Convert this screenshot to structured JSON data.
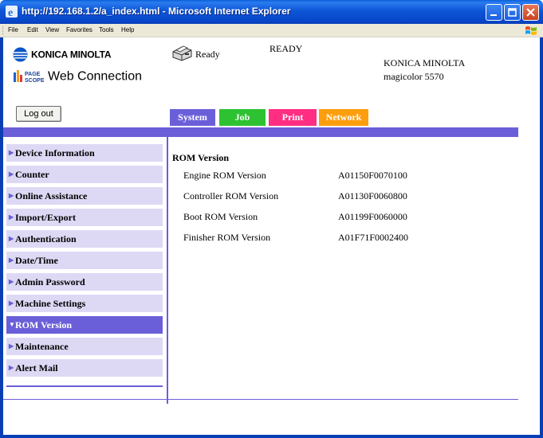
{
  "window": {
    "title": "http://192.168.1.2/a_index.html - Microsoft Internet Explorer",
    "menu": [
      "File",
      "Edit",
      "View",
      "Favorites",
      "Tools",
      "Help"
    ]
  },
  "header": {
    "brand_logo": "KONICA MINOLTA",
    "app_logo": "Web Connection",
    "printer_status_icon": "printer-icon",
    "ready_label": "Ready",
    "status_message": "READY",
    "model_brand": "KONICA MINOLTA",
    "model_name": "magicolor 5570",
    "logout_label": "Log out"
  },
  "tabs": [
    {
      "label": "System",
      "color": "#6b5fd9",
      "active": true
    },
    {
      "label": "Job",
      "color": "#2ec232"
    },
    {
      "label": "Print",
      "color": "#ff2e82"
    },
    {
      "label": "Network",
      "color": "#ff9e0d"
    }
  ],
  "sidebar": {
    "items": [
      {
        "label": "Device Information"
      },
      {
        "label": "Counter"
      },
      {
        "label": "Online Assistance"
      },
      {
        "label": "Import/Export"
      },
      {
        "label": "Authentication"
      },
      {
        "label": "Date/Time"
      },
      {
        "label": "Admin Password"
      },
      {
        "label": "Machine Settings"
      },
      {
        "label": "ROM Version",
        "active": true
      },
      {
        "label": "Maintenance"
      },
      {
        "label": "Alert Mail"
      }
    ]
  },
  "content": {
    "title": "ROM Version",
    "rows": [
      {
        "label": "Engine ROM Version",
        "value": "A01150F0070100"
      },
      {
        "label": "Controller ROM Version",
        "value": "A01130F0060800"
      },
      {
        "label": "Boot ROM Version",
        "value": "A01199F0060000"
      },
      {
        "label": "Finisher ROM Version",
        "value": "A01F71F0002400"
      }
    ]
  },
  "colors": {
    "accent": "#6b5fd9",
    "nav_bg": "#ddd9f5",
    "xp_blue": "#0a3fb4"
  }
}
